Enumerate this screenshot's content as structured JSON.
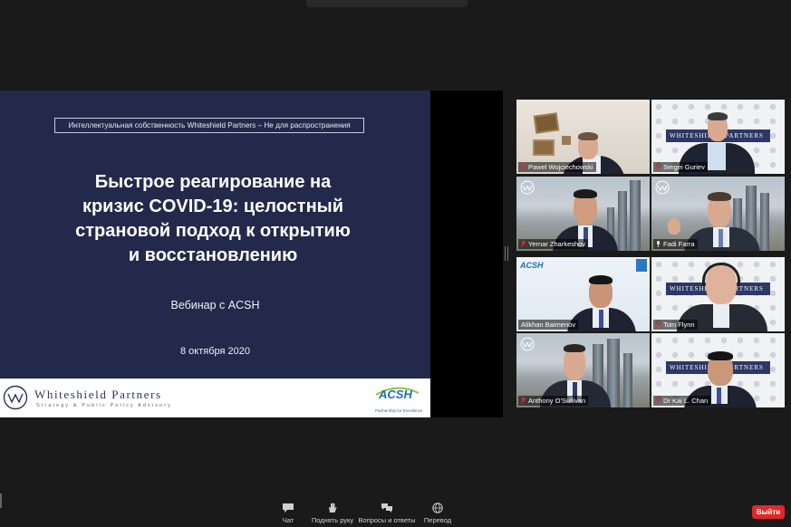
{
  "slide": {
    "banner": "Интеллектуальная собственность Whiteshield Partners – Не для распространения",
    "title_lines": [
      "Быстрое реагирование на",
      "кризис COVID-19: целостный",
      "страновой подход к открытию",
      "и восстановлению"
    ],
    "subtitle": "Вебинар с ACSH",
    "date": "8 октября 2020",
    "footer": {
      "company": "Whiteshield Partners",
      "tagline": "Strategy & Public Policy Advisory",
      "partner_logo": "ACSH",
      "partner_tagline": "Partnership for Excellence"
    }
  },
  "gallery": {
    "participants": [
      {
        "name": "Pawel Wojciechowski",
        "muted": true,
        "active": false,
        "icon": "mic-muted-icon"
      },
      {
        "name": "Sergei Guriev",
        "muted": true,
        "active": false,
        "icon": "mic-muted-icon"
      },
      {
        "name": "Yernar Zharkeshov",
        "muted": true,
        "active": false,
        "icon": "mic-muted-icon"
      },
      {
        "name": "Fadi Farra",
        "muted": false,
        "active": true,
        "icon": "mic-icon"
      },
      {
        "name": "Alikhan Baimenov",
        "muted": false,
        "active": false,
        "icon": ""
      },
      {
        "name": "Tom Flynn",
        "muted": true,
        "active": false,
        "icon": "mic-muted-icon"
      },
      {
        "name": "Anthony O'Sullivan",
        "muted": true,
        "active": false,
        "icon": "mic-muted-icon"
      },
      {
        "name": "Dr Kai L. Chan",
        "muted": true,
        "active": false,
        "icon": "mic-muted-icon"
      }
    ],
    "banner_text": "WHITESHIELD PARTNERS",
    "acsh_label": "ACSH"
  },
  "toolbar": {
    "chat": "Чат",
    "raise_hand": "Поднять руку",
    "qa": "Вопросы и ответы",
    "translate": "Перевод",
    "leave": "Выйти"
  },
  "colors": {
    "slide_bg": "#23294a",
    "active_speaker": "#b7e35a",
    "leave_button": "#e02828",
    "brand_navy": "#2d3866",
    "acsh_blue": "#1c6fb5"
  }
}
